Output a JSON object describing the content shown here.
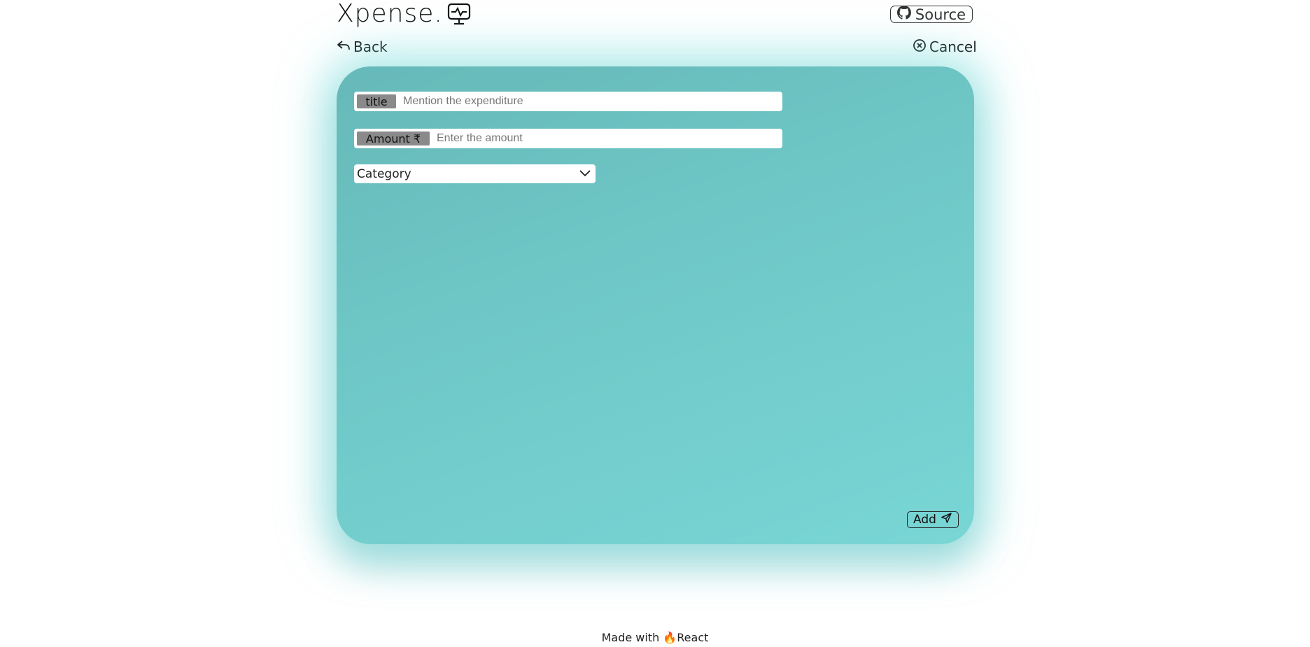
{
  "header": {
    "brand": "Xpense.",
    "brand_icon": "monitor-pulse-icon",
    "source_label": "Source",
    "source_icon": "github-icon"
  },
  "nav": {
    "back_label": "Back",
    "back_icon": "reply-arrow-icon",
    "cancel_label": "Cancel",
    "cancel_icon": "x-circle-icon"
  },
  "form": {
    "title_tag": "title",
    "title_placeholder": "Mention the expenditure",
    "title_value": "",
    "amount_tag": "Amount ₹",
    "amount_placeholder": "Enter the amount",
    "amount_value": "",
    "category_selected": "Category",
    "add_label": "Add",
    "add_icon": "send-icon"
  },
  "footer": {
    "made_with": "Made with",
    "flame_icon": "fire-icon",
    "react": "React"
  },
  "colors": {
    "card_start": "#66b9b8",
    "card_end": "#78d6d5",
    "tag_bg": "#8a8a8a"
  }
}
